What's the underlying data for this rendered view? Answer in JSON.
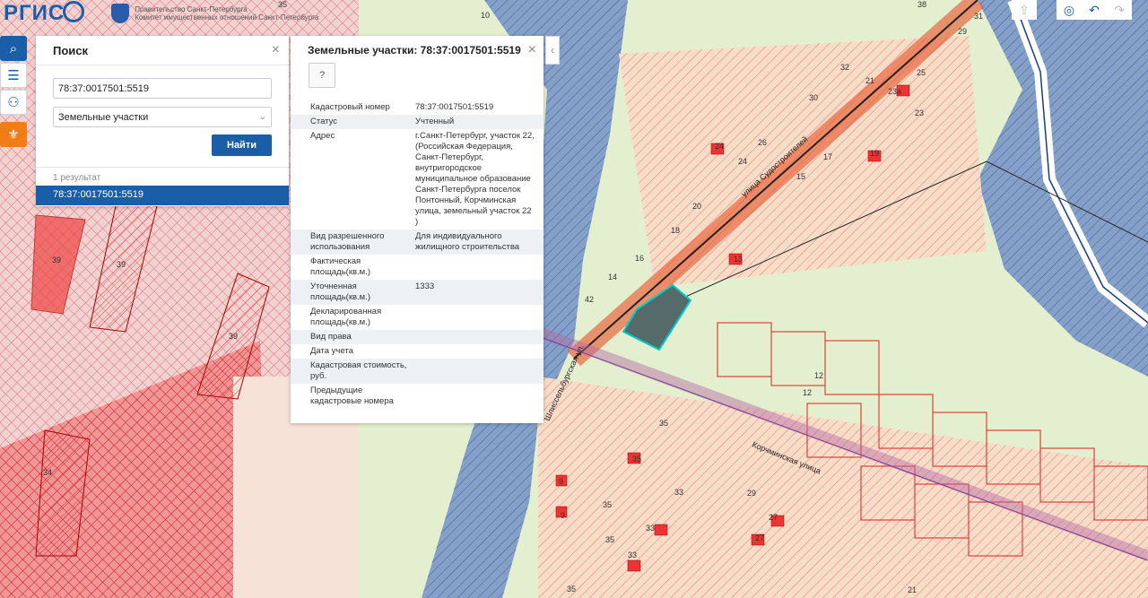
{
  "logo": {
    "text": "РГИС"
  },
  "org": {
    "line1": "Правительство Санкт-Петербурга",
    "line2": "Комитет имущественных отношений Санкт-Петербурга"
  },
  "search": {
    "title": "Поиск",
    "query": "78:37:0017501:5519",
    "layer": "Земельные участки",
    "find_label": "Найти",
    "result_count": "1 результат",
    "result_item": "78:37:0017501:5519"
  },
  "info": {
    "title": "Земельные участки: 78:37:0017501:5519",
    "help_label": "?",
    "rows": [
      {
        "label": "Кадастровый номер",
        "value": "78:37:0017501:5519"
      },
      {
        "label": "Статус",
        "value": "Учтенный"
      },
      {
        "label": "Адрес",
        "value": "г.Санкт-Петербург, участок 22, (Российская Федерация, Санкт-Петербург, внутригородское муниципальное образование Санкт-Петербурга поселок Понтонный, Корчминская улица, земельный участок 22 )"
      },
      {
        "label": "Вид разрешенного использования",
        "value": "Для индивидуального жилищного строительства"
      },
      {
        "label": "Фактическая площадь(кв.м.)",
        "value": ""
      },
      {
        "label": "Уточненная площадь(кв.м.)",
        "value": "1333"
      },
      {
        "label": "Декларированная площадь(кв.м.)",
        "value": ""
      },
      {
        "label": "Вид права",
        "value": ""
      },
      {
        "label": "Дата учета",
        "value": ""
      },
      {
        "label": "Кадастровая стоимость, руб.",
        "value": ""
      },
      {
        "label": "Предыдущие кадастровые номера",
        "value": ""
      }
    ]
  },
  "map_labels": {
    "street1": "улица Судостроителей",
    "street2": "Корчминская улица",
    "street3": "Шлиссельбургская ул.",
    "parcels": [
      "39",
      "39",
      "39",
      "35",
      "35",
      "35",
      "33",
      "33",
      "29",
      "27",
      "27",
      "21",
      "21",
      "23",
      "25",
      "26",
      "24",
      "24",
      "20",
      "18",
      "16",
      "13",
      "12",
      "12",
      "14",
      "15",
      "17",
      "19",
      "30",
      "32",
      "38",
      "31",
      "42",
      "9",
      "9",
      "10",
      "23а",
      "34"
    ]
  },
  "colors": {
    "accent": "#1b5ea8",
    "orange": "#f07d18"
  }
}
